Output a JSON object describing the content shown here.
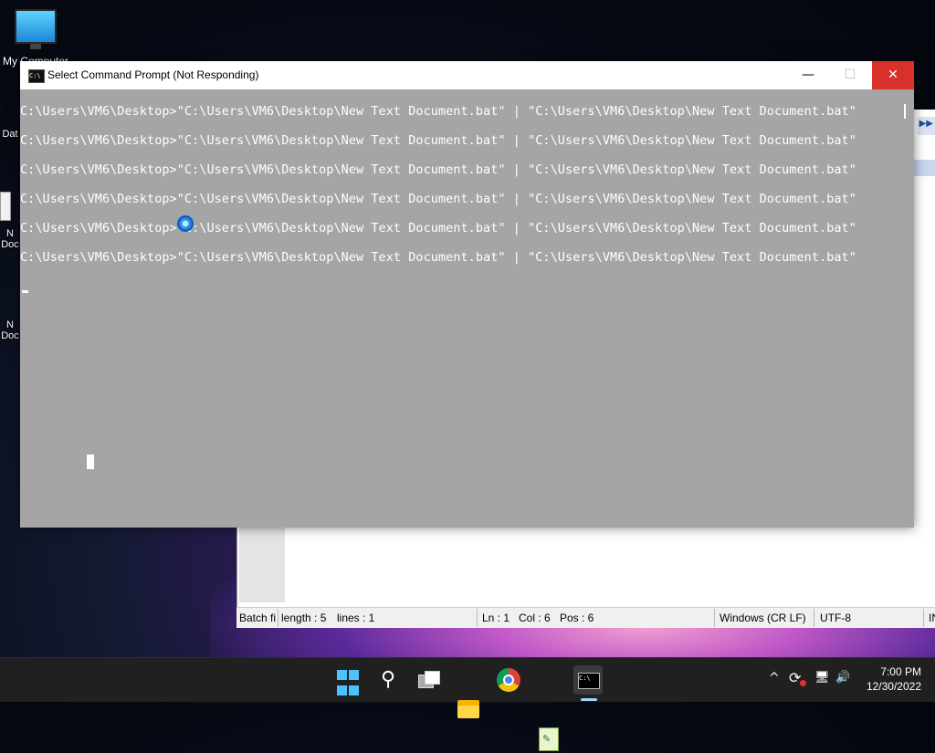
{
  "desktop": {
    "icons": [
      {
        "label": "My Computer"
      },
      {
        "label": "Dat"
      },
      {
        "label": "N\nDoc"
      },
      {
        "label": "N\nDoc"
      }
    ]
  },
  "cmd_window": {
    "title": "Select Command Prompt (Not Responding)",
    "icon_text": "C:\\",
    "controls": {
      "minimize": "—",
      "maximize": "☐",
      "close": "✕"
    },
    "lines": [
      "C:\\Users\\VM6\\Desktop>\"C:\\Users\\VM6\\Desktop\\New Text Document.bat\" | \"C:\\Users\\VM6\\Desktop\\New Text Document.bat\"",
      "C:\\Users\\VM6\\Desktop>\"C:\\Users\\VM6\\Desktop\\New Text Document.bat\" | \"C:\\Users\\VM6\\Desktop\\New Text Document.bat\"",
      "C:\\Users\\VM6\\Desktop>\"C:\\Users\\VM6\\Desktop\\New Text Document.bat\" | \"C:\\Users\\VM6\\Desktop\\New Text Document.bat\"",
      "C:\\Users\\VM6\\Desktop>\"C:\\Users\\VM6\\Desktop\\New Text Document.bat\" | \"C:\\Users\\VM6\\Desktop\\New Text Document.bat\"",
      "C:\\Users\\VM6\\Desktop>\"C:\\Users\\VM6\\Desktop\\New Text Document.bat\" | \"C:\\Users\\VM6\\Desktop\\New Text Document.bat\"",
      "C:\\Users\\VM6\\Desktop>\"C:\\Users\\VM6\\Desktop\\New Text Document.bat\" | \"C:\\Users\\VM6\\Desktop\\New Text Document.bat\""
    ]
  },
  "notepadpp": {
    "status": {
      "filetype": "Batch fi",
      "length": "length : 5",
      "lines": "lines : 1",
      "ln": "Ln : 1",
      "col": "Col : 6",
      "pos": "Pos : 6",
      "eol": "Windows (CR LF)",
      "encoding": "UTF-8",
      "ins": "IN"
    }
  },
  "taskbar": {
    "items": [
      "start-icon",
      "search-icon",
      "task-view-icon",
      "file-explorer-icon",
      "chrome-icon",
      "notepadpp-icon",
      "terminal-icon"
    ],
    "tray": {
      "chevron": "^",
      "sync": "⟳",
      "network": "🖥",
      "volume": "🔊"
    },
    "clock_time": "7:00 PM",
    "clock_date": "12/30/2022"
  }
}
